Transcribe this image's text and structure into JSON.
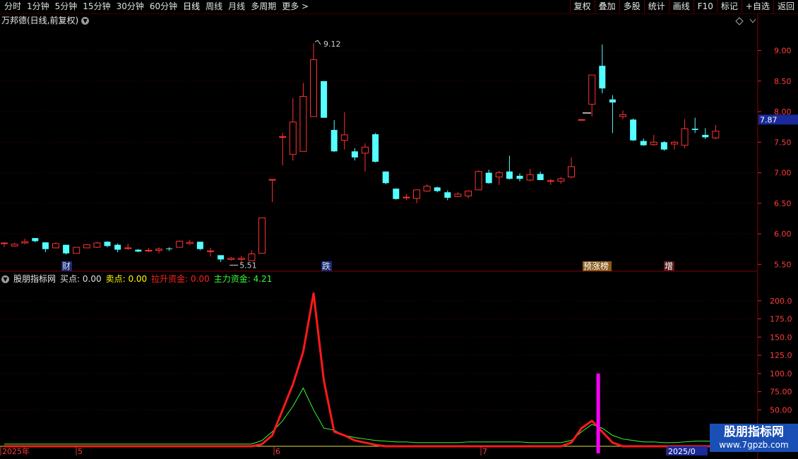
{
  "toolbar": {
    "periods": [
      "分时",
      "1分钟",
      "5分钟",
      "15分钟",
      "30分钟",
      "60分钟",
      "日线",
      "周线",
      "月线",
      "多周期",
      "更多"
    ],
    "active_period": "日线",
    "more_arrow": ">",
    "right_buttons": [
      "复权",
      "叠加",
      "多股",
      "统计",
      "画线",
      "F10",
      "标记",
      "+自选",
      "返回"
    ]
  },
  "main_chart": {
    "title": "万邦德(日线,前复权)",
    "price_axis": [
      "9.00",
      "8.50",
      "8.00",
      "7.50",
      "7.00",
      "6.50",
      "6.00",
      "5.50"
    ],
    "current_price": "7.87",
    "high_label": "9.12",
    "low_label": "5.51",
    "markers": [
      "财",
      "跌",
      "预涨榜",
      "增"
    ]
  },
  "indicator": {
    "name": "股朋指标网",
    "fields": [
      {
        "label": "买点:",
        "value": "0.00",
        "color": "#e0e0e0"
      },
      {
        "label": "卖点:",
        "value": "0.00",
        "color": "#ffff00"
      },
      {
        "label": "拉升资金:",
        "value": "0.00",
        "color": "#ff2020"
      },
      {
        "label": "主力资金:",
        "value": "4.21",
        "color": "#33ff33"
      }
    ],
    "axis": [
      "200.0",
      "175.0",
      "150.0",
      "125.0",
      "100.0",
      "75.00",
      "50.00"
    ]
  },
  "time_axis": [
    "2025年",
    "5",
    "6",
    "7",
    "2025/0"
  ],
  "watermark": {
    "title": "股朋指标网",
    "url": "www.7gpzb.com"
  },
  "colors": {
    "up": "#ff3232",
    "down": "#54ffff",
    "bg": "#000000",
    "grid": "#5a0000",
    "magenta": "#ff00ff"
  },
  "chart_data": {
    "type": "candlestick",
    "candles": [
      [
        5.85,
        5.85,
        5.86,
        5.78
      ],
      [
        5.8,
        5.83,
        5.85,
        5.79
      ],
      [
        5.85,
        5.87,
        5.92,
        5.83
      ],
      [
        5.93,
        5.88,
        5.93,
        5.86
      ],
      [
        5.86,
        5.75,
        5.86,
        5.7
      ],
      [
        5.77,
        5.84,
        5.86,
        5.76
      ],
      [
        5.82,
        5.68,
        5.82,
        5.66
      ],
      [
        5.68,
        5.78,
        5.78,
        5.68
      ],
      [
        5.77,
        5.82,
        5.83,
        5.77
      ],
      [
        5.78,
        5.85,
        5.87,
        5.77
      ],
      [
        5.87,
        5.8,
        5.88,
        5.78
      ],
      [
        5.82,
        5.74,
        5.84,
        5.7
      ],
      [
        5.77,
        5.77,
        5.84,
        5.74
      ],
      [
        5.74,
        5.71,
        5.75,
        5.7
      ],
      [
        5.72,
        5.73,
        5.77,
        5.7
      ],
      [
        5.73,
        5.75,
        5.78,
        5.68
      ],
      [
        5.76,
        5.75,
        5.78,
        5.72
      ],
      [
        5.78,
        5.88,
        5.89,
        5.78
      ],
      [
        5.84,
        5.86,
        5.9,
        5.82
      ],
      [
        5.87,
        5.75,
        5.87,
        5.73
      ],
      [
        5.72,
        5.72,
        5.77,
        5.63
      ],
      [
        5.65,
        5.58,
        5.65,
        5.54
      ],
      [
        5.58,
        5.6,
        5.62,
        5.56
      ],
      [
        5.58,
        5.6,
        5.64,
        5.52
      ],
      [
        5.56,
        5.67,
        5.73,
        5.56
      ],
      [
        5.68,
        6.26,
        6.26,
        5.68
      ],
      [
        6.89,
        6.89,
        6.89,
        6.52
      ],
      [
        7.59,
        7.59,
        7.65,
        7.12
      ],
      [
        7.3,
        7.83,
        8.22,
        7.2
      ],
      [
        7.35,
        8.25,
        8.47,
        7.35
      ],
      [
        7.92,
        8.85,
        9.12,
        7.92
      ],
      [
        8.5,
        7.9,
        8.5,
        7.9
      ],
      [
        7.7,
        7.35,
        7.86,
        7.34
      ],
      [
        7.53,
        7.62,
        7.99,
        7.38
      ],
      [
        7.35,
        7.25,
        7.4,
        7.2
      ],
      [
        7.32,
        7.42,
        7.48,
        7.02
      ],
      [
        7.63,
        7.18,
        7.65,
        7.17
      ],
      [
        7.02,
        6.83,
        7.02,
        6.81
      ],
      [
        6.74,
        6.57,
        6.74,
        6.56
      ],
      [
        6.6,
        6.6,
        6.65,
        6.55
      ],
      [
        6.58,
        6.72,
        6.72,
        6.5
      ],
      [
        6.7,
        6.78,
        6.81,
        6.69
      ],
      [
        6.76,
        6.7,
        6.77,
        6.68
      ],
      [
        6.68,
        6.59,
        6.71,
        6.55
      ],
      [
        6.61,
        6.65,
        6.68,
        6.6
      ],
      [
        6.62,
        6.7,
        6.71,
        6.58
      ],
      [
        6.72,
        7.02,
        7.04,
        6.72
      ],
      [
        7.0,
        6.83,
        7.05,
        6.82
      ],
      [
        6.93,
        7.0,
        7.03,
        6.8
      ],
      [
        7.02,
        6.9,
        7.28,
        6.89
      ],
      [
        6.95,
        6.9,
        6.99,
        6.86
      ],
      [
        6.88,
        6.97,
        7.06,
        6.86
      ],
      [
        6.98,
        6.88,
        7.02,
        6.88
      ],
      [
        6.87,
        6.87,
        6.9,
        6.8
      ],
      [
        6.86,
        6.9,
        6.93,
        6.82
      ],
      [
        6.93,
        7.1,
        7.25,
        6.91
      ],
      [
        7.87,
        7.87,
        7.87,
        7.87
      ],
      [
        8.12,
        8.6,
        8.6,
        7.92
      ],
      [
        8.75,
        8.38,
        9.1,
        8.3
      ],
      [
        8.2,
        8.15,
        8.27,
        7.65
      ],
      [
        7.92,
        7.95,
        8.02,
        7.88
      ],
      [
        7.87,
        7.53,
        7.89,
        7.52
      ],
      [
        7.52,
        7.45,
        7.56,
        7.44
      ],
      [
        7.46,
        7.5,
        7.62,
        7.44
      ],
      [
        7.5,
        7.38,
        7.52,
        7.36
      ],
      [
        7.47,
        7.5,
        7.52,
        7.38
      ],
      [
        7.45,
        7.72,
        7.88,
        7.4
      ],
      [
        7.72,
        7.7,
        7.9,
        7.65
      ],
      [
        7.62,
        7.58,
        7.73,
        7.55
      ],
      [
        7.57,
        7.68,
        7.78,
        7.55
      ]
    ],
    "ylim": [
      5.4,
      9.4
    ],
    "indicator_ylim": [
      0,
      225
    ],
    "lasheng_zijin": [
      0,
      0,
      0,
      0,
      0,
      0,
      0,
      0,
      0,
      0,
      0,
      0,
      0,
      0,
      0,
      0,
      0,
      0,
      0,
      0,
      0,
      0,
      0,
      0,
      0,
      3,
      15,
      50,
      85,
      130,
      210,
      90,
      20,
      15,
      8,
      5,
      2,
      0,
      0,
      0,
      0,
      0,
      0,
      0,
      0,
      0,
      0,
      0,
      0,
      0,
      0,
      0,
      0,
      0,
      0,
      5,
      25,
      35,
      20,
      5,
      0,
      0,
      0,
      0,
      0,
      0,
      0,
      0,
      0,
      0
    ],
    "zhuli_zijin": [
      3,
      3,
      3,
      3,
      3,
      3,
      3,
      3,
      3,
      3,
      3,
      3,
      3,
      3,
      3,
      3,
      3,
      3,
      3,
      3,
      3,
      3,
      3,
      3,
      3,
      8,
      20,
      35,
      55,
      80,
      50,
      25,
      22,
      15,
      12,
      10,
      8,
      7,
      6,
      6,
      5,
      5,
      5,
      5,
      5,
      6,
      6,
      6,
      6,
      6,
      6,
      5,
      5,
      5,
      5,
      8,
      20,
      30,
      25,
      15,
      10,
      8,
      6,
      6,
      5,
      5,
      6,
      7,
      7,
      7
    ],
    "signal_bar": {
      "index": 56,
      "value": 100
    }
  }
}
